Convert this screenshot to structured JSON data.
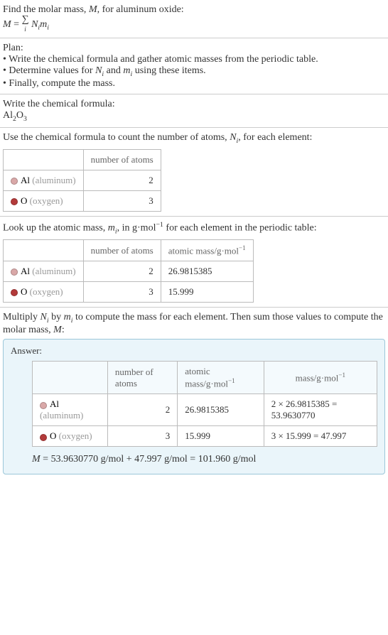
{
  "intro": {
    "line1_a": "Find the molar mass, ",
    "line1_b": ", for aluminum oxide:",
    "eq_M": "M",
    "eq_equals": " = ",
    "eq_sigma": "∑",
    "eq_sigma_sub": "i",
    "eq_Ni": "N",
    "eq_Ni_sub": "i",
    "eq_mi": "m",
    "eq_mi_sub": "i"
  },
  "plan": {
    "heading": "Plan:",
    "b1_a": "• Write the chemical formula and gather atomic masses from the periodic table.",
    "b2_a": "• Determine values for ",
    "b2_b": " and ",
    "b2_c": " using these items.",
    "b3_a": "• Finally, compute the mass."
  },
  "formula_section": {
    "heading": "Write the chemical formula:",
    "al": "Al",
    "al_sub": "2",
    "o": "O",
    "o_sub": "3"
  },
  "count_section": {
    "heading_a": "Use the chemical formula to count the number of atoms, ",
    "heading_b": ", for each element:",
    "col_atoms": "number of atoms",
    "rows": [
      {
        "sym": "Al",
        "name": "(aluminum)",
        "atoms": "2"
      },
      {
        "sym": "O",
        "name": "(oxygen)",
        "atoms": "3"
      }
    ]
  },
  "mass_section": {
    "heading_a": "Look up the atomic mass, ",
    "heading_b": ", in g·mol",
    "heading_c": " for each element in the periodic table:",
    "exp_neg1": "−1",
    "col_atoms": "number of atoms",
    "col_mass_a": "atomic mass/g·mol",
    "rows": [
      {
        "sym": "Al",
        "name": "(aluminum)",
        "atoms": "2",
        "mass": "26.9815385"
      },
      {
        "sym": "O",
        "name": "(oxygen)",
        "atoms": "3",
        "mass": "15.999"
      }
    ]
  },
  "mult_section": {
    "heading_a": "Multiply ",
    "heading_b": " by ",
    "heading_c": " to compute the mass for each element. Then sum those values to compute the molar mass, ",
    "heading_d": ":"
  },
  "answer": {
    "label": "Answer:",
    "col_atoms": "number of atoms",
    "col_mass_a": "atomic mass/g·mol",
    "col_total_a": "mass/g·mol",
    "exp_neg1": "−1",
    "rows": [
      {
        "sym": "Al",
        "name": "(aluminum)",
        "atoms": "2",
        "mass": "26.9815385",
        "calc": "2 × 26.9815385 = 53.9630770"
      },
      {
        "sym": "O",
        "name": "(oxygen)",
        "atoms": "3",
        "mass": "15.999",
        "calc": "3 × 15.999 = 47.997"
      }
    ],
    "final_a": "M",
    "final_b": " = 53.9630770 g/mol + 47.997 g/mol = 101.960 g/mol"
  },
  "chart_data": {
    "type": "table",
    "title": "Molar mass computation for aluminum oxide (Al2O3)",
    "columns": [
      "element",
      "number_of_atoms",
      "atomic_mass_g_per_mol",
      "mass_g_per_mol"
    ],
    "rows": [
      {
        "element": "Al",
        "number_of_atoms": 2,
        "atomic_mass_g_per_mol": 26.9815385,
        "mass_g_per_mol": 53.963077
      },
      {
        "element": "O",
        "number_of_atoms": 3,
        "atomic_mass_g_per_mol": 15.999,
        "mass_g_per_mol": 47.997
      }
    ],
    "total_molar_mass_g_per_mol": 101.96
  }
}
